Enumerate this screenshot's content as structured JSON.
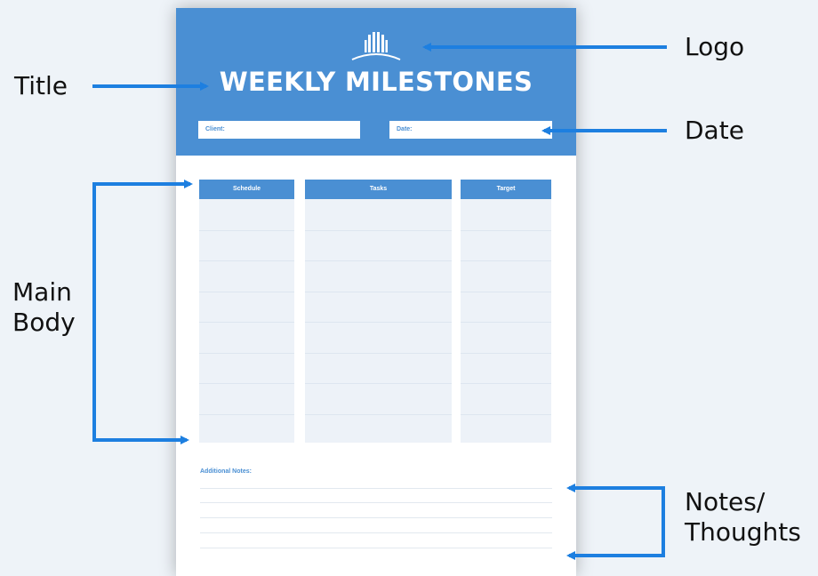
{
  "callouts": {
    "title": "Title",
    "logo": "Logo",
    "date": "Date",
    "main_body_line1": "Main",
    "main_body_line2": "Body",
    "notes_line1": "Notes/",
    "notes_line2": "Thoughts"
  },
  "template": {
    "title": "WEEKLY MILESTONES",
    "client_label": "Client:",
    "date_label": "Date:",
    "columns": [
      "Schedule",
      "Tasks",
      "Target"
    ],
    "notes_label": "Additional Notes:"
  },
  "colors": {
    "header_blue": "#4a8fd3",
    "arrow_blue": "#1d7fe0",
    "cell_fill": "#edf2f8",
    "background": "#eef3f8"
  },
  "icons": {
    "logo": "building-logo-icon"
  }
}
